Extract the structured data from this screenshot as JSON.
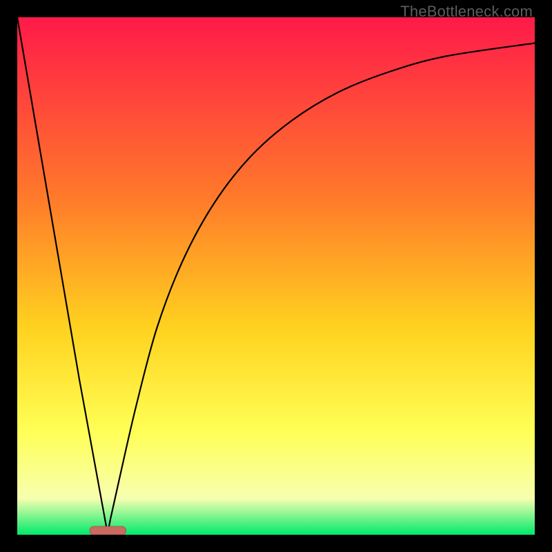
{
  "watermark": "TheBottleneck.com",
  "colors": {
    "frame": "#000000",
    "grad_top": "#ff1a49",
    "grad_mid1": "#ff7a2a",
    "grad_mid2": "#ffd21f",
    "grad_mid3": "#ffff55",
    "grad_mid4": "#f7ffb0",
    "grad_bottom": "#00e96a",
    "curve": "#000000",
    "pill_fill": "#c96a63",
    "pill_stroke": "#b2504d"
  },
  "chart_data": {
    "type": "line",
    "title": "",
    "xlabel": "",
    "ylabel": "",
    "xlim": [
      0,
      100
    ],
    "ylim": [
      0,
      100
    ],
    "series": [
      {
        "name": "left-branch",
        "x": [
          0,
          12,
          17.5
        ],
        "values": [
          100,
          30,
          0
        ]
      },
      {
        "name": "right-branch",
        "x": [
          17.5,
          18,
          20,
          23,
          27,
          32,
          38,
          45,
          53,
          62,
          72,
          83,
          100
        ],
        "values": [
          0,
          3,
          12,
          25,
          40,
          53,
          64,
          73,
          80,
          85.5,
          89.5,
          92.5,
          95
        ]
      }
    ],
    "annotations": [
      {
        "name": "pill-marker",
        "x_center": 17.5,
        "y": 0.5,
        "width": 7
      }
    ],
    "axes_visible": false,
    "ticks_visible": false,
    "background": "vertical-gradient-red-to-green"
  }
}
